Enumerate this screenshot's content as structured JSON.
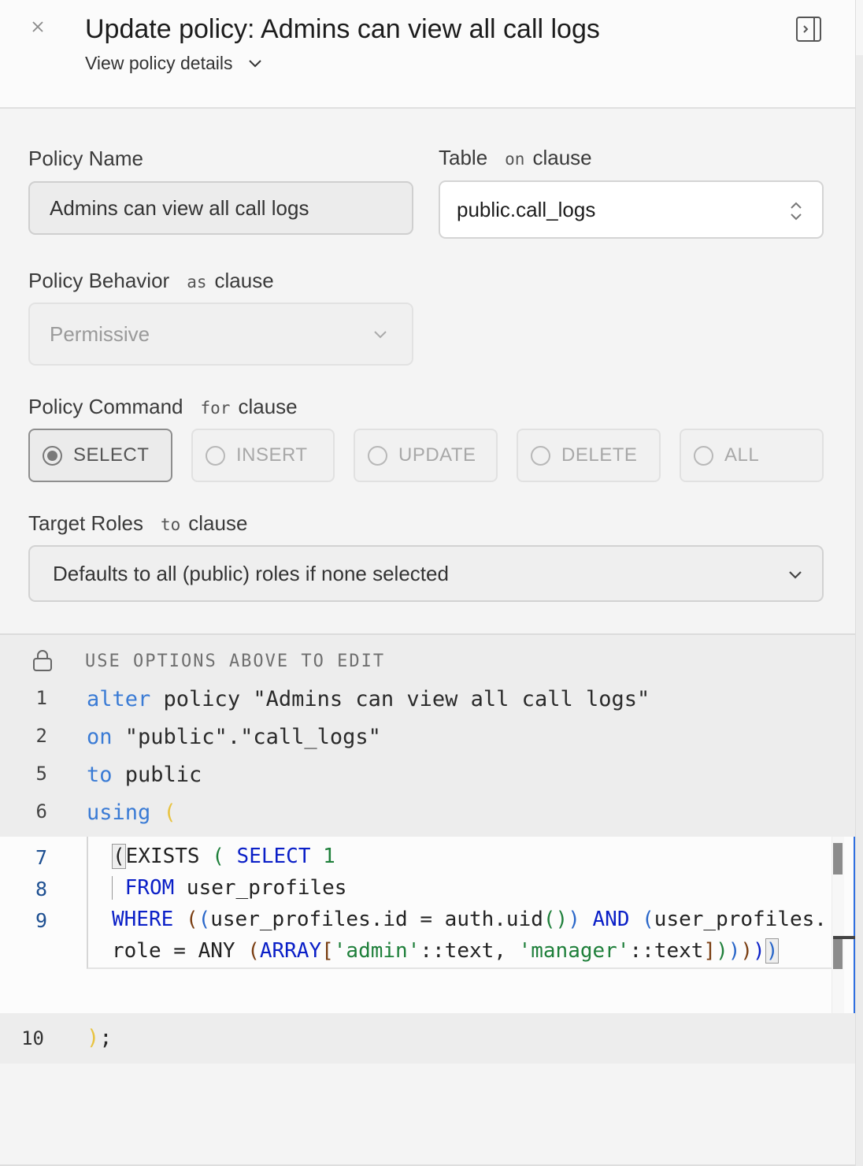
{
  "header": {
    "title": "Update policy: Admins can view all call logs",
    "subtitle": "View policy details"
  },
  "form": {
    "policy_name": {
      "label": "Policy Name",
      "value": "Admins can view all call logs"
    },
    "table": {
      "label": "Table",
      "keyword": "on",
      "clause": "clause",
      "value": "public.call_logs"
    },
    "behavior": {
      "label": "Policy Behavior",
      "keyword": "as",
      "clause": "clause",
      "value": "Permissive"
    },
    "command": {
      "label": "Policy Command",
      "keyword": "for",
      "clause": "clause",
      "options": [
        "SELECT",
        "INSERT",
        "UPDATE",
        "DELETE",
        "ALL"
      ],
      "selected": "SELECT"
    },
    "roles": {
      "label": "Target Roles",
      "keyword": "to",
      "clause": "clause",
      "placeholder": "Defaults to all (public) roles if none selected"
    }
  },
  "code": {
    "locked_notice": "USE OPTIONS ABOVE TO EDIT",
    "lines": [
      {
        "num": "1",
        "kw": "alter",
        "rest": " policy \"Admins can view all call logs\""
      },
      {
        "num": "2",
        "kw": "on",
        "rest": " \"public\".\"call_logs\""
      },
      {
        "num": "5",
        "kw": "to",
        "rest": " public"
      },
      {
        "num": "6",
        "kw": "using",
        "rest": " ("
      }
    ],
    "editor_line_numbers": [
      "7",
      "8",
      "9"
    ],
    "last_line_num": "10",
    "last_line": ");"
  },
  "colors": {
    "keyword": "#3a7bd5",
    "sql_keyword": "#0a1fc7",
    "string": "#1e7f3a",
    "accent": "#2f6fe0"
  },
  "icons": {
    "close": "close-icon",
    "panel": "panel-toggle-icon",
    "lock": "lock-icon",
    "chevron": "chevron-down-icon",
    "updown": "chevron-up-down-icon"
  }
}
